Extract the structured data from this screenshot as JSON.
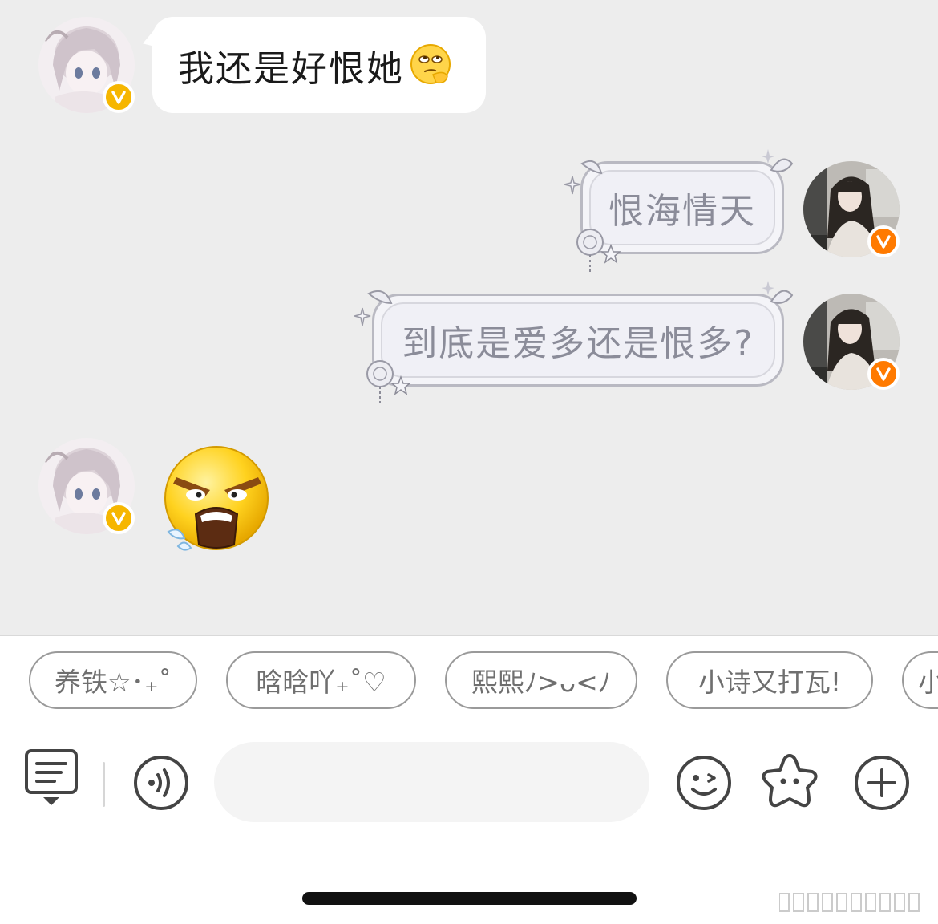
{
  "messages": [
    {
      "side": "left",
      "kind": "text",
      "text": "我还是好恨她",
      "emoji": "face-with-rolling-eyes-thinking-icon"
    },
    {
      "side": "right",
      "kind": "decorated-text",
      "text": "恨海情天"
    },
    {
      "side": "right",
      "kind": "decorated-text",
      "text": "到底是爱多还是恨多?"
    },
    {
      "side": "left",
      "kind": "sticker",
      "sticker": "angry-shouting-face-icon"
    }
  ],
  "quick_replies": [
    "养铁☆･₊˚",
    "晗晗吖₊˚♡",
    "熙熙ﾉ>ᴗ<ﾉ",
    "小诗又打瓦!",
    "小"
  ],
  "toolbar": {
    "left_icons": [
      "message-list-icon",
      "voice-icon"
    ],
    "right_icons": [
      "emoji-face-icon",
      "star-sticker-icon",
      "plus-icon"
    ]
  },
  "colors": {
    "chat_background": "#ededed",
    "badge_yellow": "#f6b600",
    "badge_orange": "#ff7a00",
    "decorated_text": "#8b8c99"
  }
}
